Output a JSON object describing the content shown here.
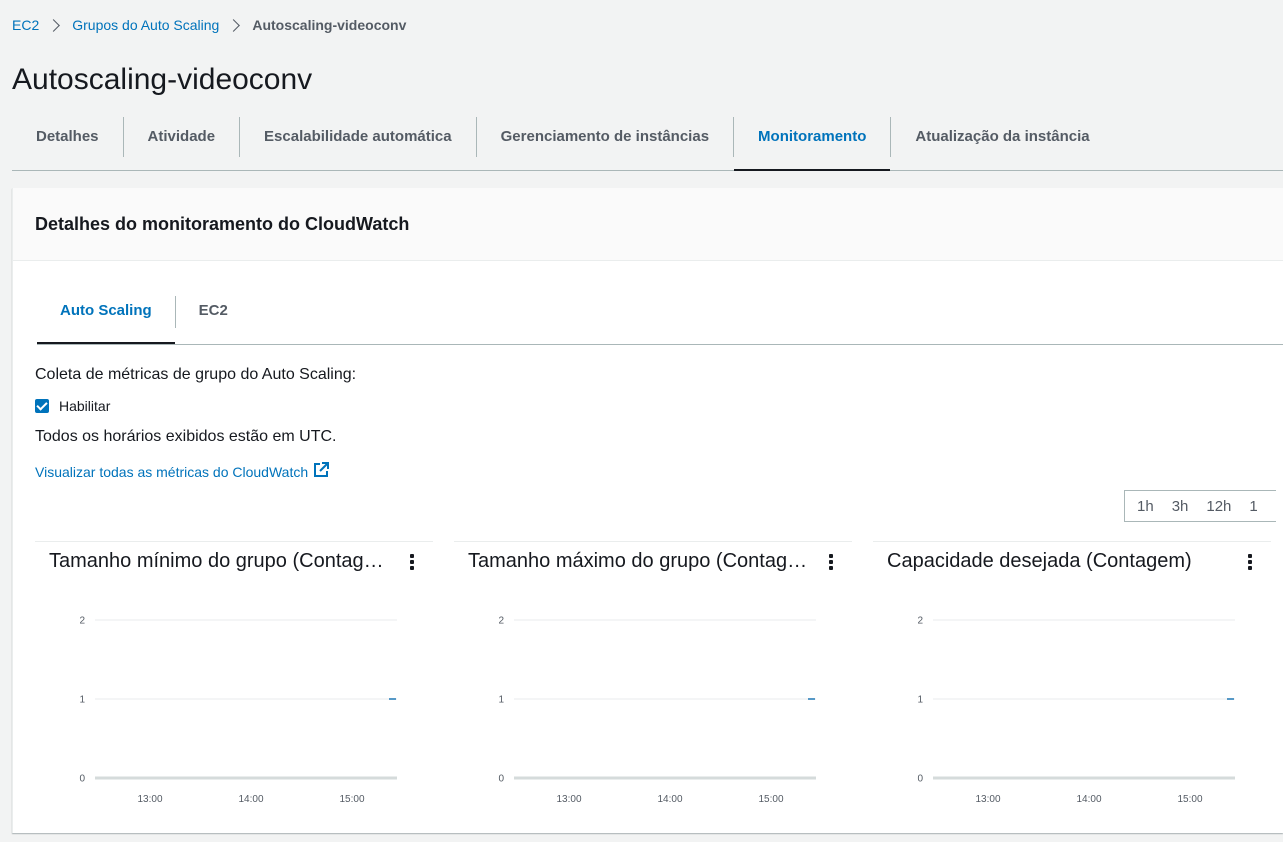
{
  "breadcrumb": {
    "items": [
      "EC2",
      "Grupos do Auto Scaling"
    ],
    "current": "Autoscaling-videoconv"
  },
  "page": {
    "title": "Autoscaling-videoconv"
  },
  "tabs": [
    {
      "label": "Detalhes"
    },
    {
      "label": "Atividade"
    },
    {
      "label": "Escalabilidade automática"
    },
    {
      "label": "Gerenciamento de instâncias"
    },
    {
      "label": "Monitoramento",
      "active": true
    },
    {
      "label": "Atualização da instância"
    }
  ],
  "panel": {
    "title": "Detalhes do monitoramento do CloudWatch",
    "sub_tabs": [
      {
        "label": "Auto Scaling",
        "active": true
      },
      {
        "label": "EC2"
      }
    ],
    "metrics_label": "Coleta de métricas de grupo do Auto Scaling:",
    "enable_label": "Habilitar",
    "enable_checked": true,
    "utc_note": "Todos os horários exibidos estão em UTC.",
    "cloudwatch_link": "Visualizar todas as métricas do CloudWatch",
    "time_ranges": [
      "1h",
      "3h",
      "12h",
      "1"
    ]
  },
  "colors": {
    "accent": "#0073bb",
    "text": "#16191f",
    "muted": "#545b64",
    "series": "#1f77b4"
  },
  "chart_data": [
    {
      "type": "line",
      "title": "Tamanho mínimo do grupo (Contag…",
      "y_ticks": [
        "2",
        "1",
        "0"
      ],
      "x_ticks": [
        "13:00",
        "14:00",
        "15:00"
      ],
      "ylim": [
        0,
        2
      ],
      "series": [
        {
          "values": [
            1
          ]
        }
      ]
    },
    {
      "type": "line",
      "title": "Tamanho máximo do grupo (Contag…",
      "y_ticks": [
        "2",
        "1",
        "0"
      ],
      "x_ticks": [
        "13:00",
        "14:00",
        "15:00"
      ],
      "ylim": [
        0,
        2
      ],
      "series": [
        {
          "values": [
            1
          ]
        }
      ]
    },
    {
      "type": "line",
      "title": "Capacidade desejada (Contagem)",
      "y_ticks": [
        "2",
        "1",
        "0"
      ],
      "x_ticks": [
        "13:00",
        "14:00",
        "15:00"
      ],
      "ylim": [
        0,
        2
      ],
      "series": [
        {
          "values": [
            1
          ]
        }
      ]
    }
  ]
}
